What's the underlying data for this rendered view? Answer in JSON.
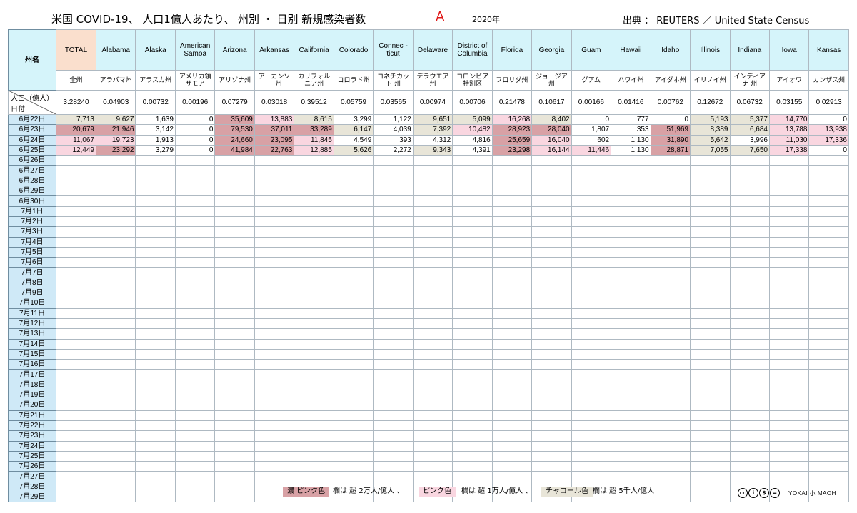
{
  "header": {
    "title": "米国 COVID-19、 人口1億人あたり、 州別 ・ 日別 新規感染者数",
    "mark": "A",
    "year": "2020年",
    "source": "出典 ： REUTERS ／ United State Census"
  },
  "table": {
    "corner_label": "州名",
    "pop_label": "人口（億人）",
    "date_label": "日付",
    "columns": [
      {
        "en": "TOTAL",
        "jp": "全州",
        "pop": "3.28240"
      },
      {
        "en": "Alabama",
        "jp": "アラバマ州",
        "pop": "0.04903"
      },
      {
        "en": "Alaska",
        "jp": "アラスカ州",
        "pop": "0.00732"
      },
      {
        "en": "American Samoa",
        "jp": "アメリカ領 サモア",
        "pop": "0.00196"
      },
      {
        "en": "Arizona",
        "jp": "アリゾナ州",
        "pop": "0.07279"
      },
      {
        "en": "Arkansas",
        "jp": "アーカンソー 州",
        "pop": "0.03018"
      },
      {
        "en": "California",
        "jp": "カリフォル ニア州",
        "pop": "0.39512"
      },
      {
        "en": "Colorado",
        "jp": "コロラド州",
        "pop": "0.05759"
      },
      {
        "en": "Connec -ticut",
        "jp": "コネチカット 州",
        "pop": "0.03565"
      },
      {
        "en": "Delaware",
        "jp": "デラウエア州",
        "pop": "0.00974"
      },
      {
        "en": "District of Columbia",
        "jp": "コロンビア 特別区",
        "pop": "0.00706"
      },
      {
        "en": "Florida",
        "jp": "フロリダ州",
        "pop": "0.21478"
      },
      {
        "en": "Georgia",
        "jp": "ジョージア州",
        "pop": "0.10617"
      },
      {
        "en": "Guam",
        "jp": "グアム",
        "pop": "0.00166"
      },
      {
        "en": "Hawaii",
        "jp": "ハワイ州",
        "pop": "0.01416"
      },
      {
        "en": "Idaho",
        "jp": "アイダホ州",
        "pop": "0.00762"
      },
      {
        "en": "Illinois",
        "jp": "イリノイ州",
        "pop": "0.12672"
      },
      {
        "en": "Indiana",
        "jp": "インディアナ 州",
        "pop": "0.06732"
      },
      {
        "en": "Iowa",
        "jp": "アイオワ",
        "pop": "0.03155"
      },
      {
        "en": "Kansas",
        "jp": "カンザス州",
        "pop": "0.02913"
      }
    ],
    "rows": [
      {
        "date": "6月22日",
        "values": [
          "7,713",
          "9,627",
          "1,639",
          "0",
          "35,609",
          "13,883",
          "8,615",
          "3,299",
          "1,122",
          "9,651",
          "5,099",
          "16,268",
          "8,402",
          "0",
          "777",
          "0",
          "5,193",
          "5,377",
          "14,770",
          "0"
        ]
      },
      {
        "date": "6月23日",
        "values": [
          "20,679",
          "21,946",
          "3,142",
          "0",
          "79,530",
          "37,011",
          "33,289",
          "6,147",
          "4,039",
          "7,392",
          "10,482",
          "28,923",
          "28,040",
          "1,807",
          "353",
          "51,969",
          "8,389",
          "6,684",
          "13,788",
          "13,938"
        ]
      },
      {
        "date": "6月24日",
        "values": [
          "11,067",
          "19,723",
          "1,913",
          "0",
          "24,660",
          "23,095",
          "11,845",
          "4,549",
          "393",
          "4,312",
          "4,816",
          "25,659",
          "16,040",
          "602",
          "1,130",
          "31,890",
          "5,642",
          "3,996",
          "11,030",
          "17,336"
        ]
      },
      {
        "date": "6月25日",
        "values": [
          "12,449",
          "23,292",
          "3,279",
          "0",
          "41,984",
          "22,763",
          "12,885",
          "5,626",
          "2,272",
          "9,343",
          "4,391",
          "23,298",
          "16,144",
          "11,446",
          "1,130",
          "28,871",
          "7,055",
          "7,650",
          "17,338",
          "0"
        ]
      },
      {
        "date": "6月26日",
        "values": []
      },
      {
        "date": "6月27日",
        "values": []
      },
      {
        "date": "6月28日",
        "values": []
      },
      {
        "date": "6月29日",
        "values": []
      },
      {
        "date": "6月30日",
        "values": []
      },
      {
        "date": "7月1日",
        "values": []
      },
      {
        "date": "7月2日",
        "values": []
      },
      {
        "date": "7月3日",
        "values": []
      },
      {
        "date": "7月4日",
        "values": []
      },
      {
        "date": "7月5日",
        "values": []
      },
      {
        "date": "7月6日",
        "values": []
      },
      {
        "date": "7月7日",
        "values": []
      },
      {
        "date": "7月8日",
        "values": []
      },
      {
        "date": "7月9日",
        "values": []
      },
      {
        "date": "7月10日",
        "values": []
      },
      {
        "date": "7月11日",
        "values": []
      },
      {
        "date": "7月12日",
        "values": []
      },
      {
        "date": "7月13日",
        "values": []
      },
      {
        "date": "7月14日",
        "values": []
      },
      {
        "date": "7月15日",
        "values": []
      },
      {
        "date": "7月16日",
        "values": []
      },
      {
        "date": "7月17日",
        "values": []
      },
      {
        "date": "7月18日",
        "values": []
      },
      {
        "date": "7月19日",
        "values": []
      },
      {
        "date": "7月20日",
        "values": []
      },
      {
        "date": "7月21日",
        "values": []
      },
      {
        "date": "7月22日",
        "values": []
      },
      {
        "date": "7月23日",
        "values": []
      },
      {
        "date": "7月24日",
        "values": []
      },
      {
        "date": "7月25日",
        "values": []
      },
      {
        "date": "7月26日",
        "values": []
      },
      {
        "date": "7月27日",
        "values": []
      },
      {
        "date": "7月28日",
        "values": []
      },
      {
        "date": "7月29日",
        "values": []
      }
    ]
  },
  "legend": {
    "dark_pink": "濃 ピンク色",
    "dark_pink_desc": "欄は 超 2万人/億人 、",
    "pink": "ピンク色",
    "pink_desc": "欄は 超 1万人/億人 、",
    "charcoal": "チャコール色",
    "charcoal_desc": "欄は 超 5千人/億人"
  },
  "colors": {
    "dark_pink": "#d8a1a5",
    "pink": "#f9d6e0",
    "charcoal": "#e8e5d8",
    "header_cyan": "#d5f4fa",
    "header_total": "#fadfcd",
    "date_col": "#cfe9f7",
    "title_mark": "#e01818"
  },
  "footer": {
    "license_icons": [
      "cc-icon",
      "by-icon",
      "nc-icon",
      "nd-icon"
    ],
    "brand": "YOKAI 小 MAOH"
  }
}
